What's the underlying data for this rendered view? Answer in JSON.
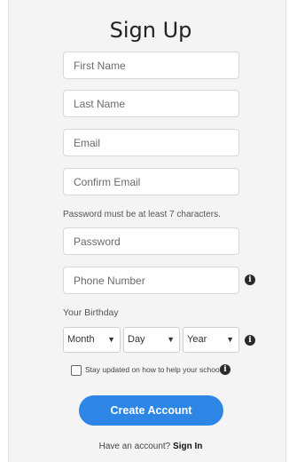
{
  "form": {
    "title": "Sign Up",
    "first_name_placeholder": "First Name",
    "last_name_placeholder": "Last Name",
    "email_placeholder": "Email",
    "confirm_email_placeholder": "Confirm Email",
    "password_hint": "Password must be at least 7 characters.",
    "password_placeholder": "Password",
    "phone_placeholder": "Phone Number",
    "birthday_label": "Your Birthday",
    "month_value": "Month",
    "day_value": "Day",
    "year_value": "Year",
    "newsletter_label": "Stay updated on how to help your school",
    "newsletter_checked": false,
    "submit_label": "Create Account",
    "footer_prompt": "Have an account?",
    "footer_link": "Sign In"
  },
  "icons": {
    "info": "info-icon",
    "dropdown": "chevron-down-icon"
  },
  "colors": {
    "panel_background": "#f4f4f4",
    "button_blue": "#2d86e6",
    "info_icon": "#2a2a2a"
  }
}
